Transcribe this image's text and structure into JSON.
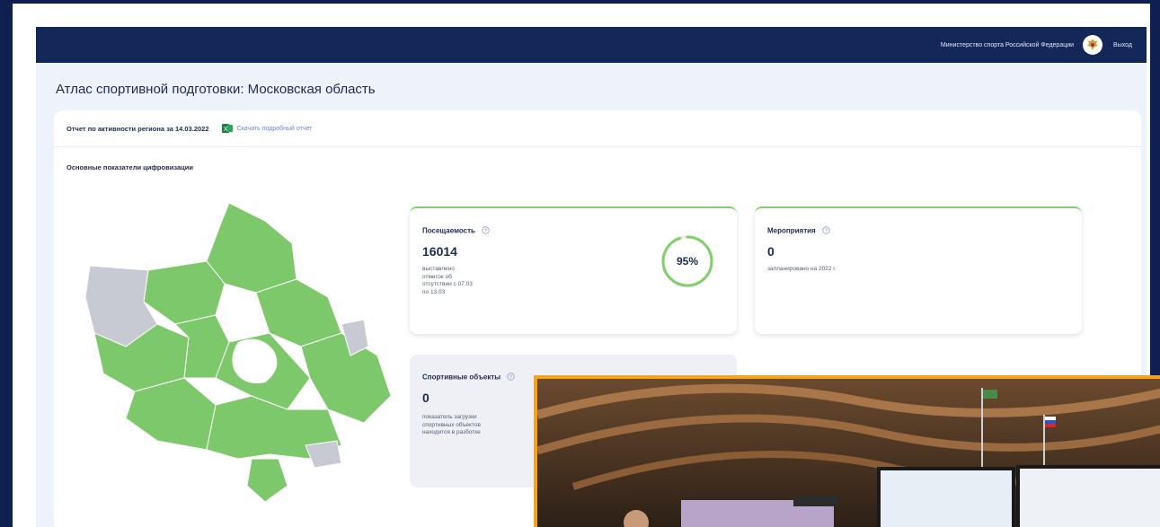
{
  "header": {
    "ministry": "Министерство спорта Российской Федерации",
    "exit_label": "Выход",
    "icons": {
      "emblem": "coat-of-arms-icon"
    }
  },
  "page": {
    "title": "Атлас спортивной подготовки: Московская область"
  },
  "report": {
    "label": "Отчет по активности региона за 14.03.2022",
    "download_label": "Скачать подробный отчет",
    "icon": "excel-icon"
  },
  "section": {
    "title": "Основные показатели цифровизации"
  },
  "map": {
    "region": "Московская область",
    "colors": {
      "active": "#7cc86a",
      "inactive": "#c7c9d3"
    }
  },
  "kpis": {
    "attendance": {
      "title": "Посещаемость",
      "value": "16014",
      "desc_lines": [
        "выставлено",
        "отметок об",
        "отсутствии с 07.03",
        "по 13.03"
      ],
      "percent_label": "95%",
      "percent_value": 0.95
    },
    "events": {
      "title": "Мероприятия",
      "value": "0",
      "desc": "запланировано на 2022 г."
    },
    "facilities": {
      "title": "Спортивные объекты",
      "value": "0",
      "desc_lines": [
        "показатель загрузки",
        "спортивных объектов",
        "находится в разботке"
      ]
    }
  },
  "colors": {
    "topbar": "#132758",
    "accent_green": "#7fcf6a",
    "background": "#0f1f4f",
    "photo_border": "#f5a31a"
  }
}
